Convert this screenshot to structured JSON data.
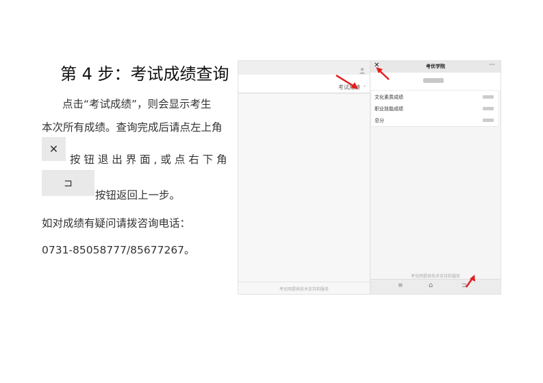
{
  "step": {
    "title": "第 4 步：考试成绩查询"
  },
  "instructions": {
    "line1": "点击“考试成绩”，则会显示考生",
    "line2": "本次所有成绩。查询完成后请点左上角",
    "line3": "按 钮 退 出 界 面 , 或 点 右 下 角",
    "line4": "按钮返回上一步。",
    "close_icon": "✕",
    "back_icon": "⊐"
  },
  "contact": {
    "line1": "如对成绩有疑问请拨咨询电话：",
    "phone": "0731-85058777/85677267。"
  },
  "screenshot": {
    "left_panel": {
      "link": "考试成绩",
      "link_chevron": "›",
      "footer": "考优网提供技术支持和服务"
    },
    "right_panel": {
      "close_icon": "✕",
      "title": "考优学院",
      "more_icon": "···",
      "rows": [
        {
          "label": "文化素质成绩"
        },
        {
          "label": "职业技能成绩"
        },
        {
          "label": "总分"
        }
      ],
      "footer": "考优网提供技术支持和服务",
      "nav": {
        "menu_icon": "≡",
        "home_icon": "⌂",
        "back_icon": "⊐"
      }
    },
    "arrow_color": "#e02020"
  }
}
